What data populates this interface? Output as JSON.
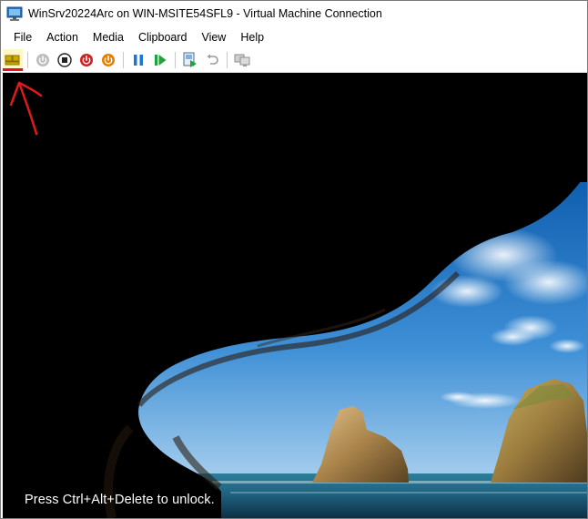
{
  "window": {
    "title": "WinSrv20224Arc on WIN-MSITE54SFL9 - Virtual Machine Connection"
  },
  "menu": {
    "items": [
      "File",
      "Action",
      "Media",
      "Clipboard",
      "View",
      "Help"
    ]
  },
  "toolbar": {
    "buttons": [
      {
        "icon": "ctrl-alt-del-icon",
        "state": "active"
      },
      {
        "icon": "start-icon",
        "state": "disabled"
      },
      {
        "icon": "turn-off-icon",
        "state": "enabled"
      },
      {
        "icon": "shut-down-icon",
        "state": "enabled"
      },
      {
        "icon": "save-icon",
        "state": "enabled"
      },
      {
        "icon": "pause-icon",
        "state": "enabled"
      },
      {
        "icon": "resume-icon",
        "state": "enabled"
      },
      {
        "icon": "checkpoint-icon",
        "state": "enabled"
      },
      {
        "icon": "revert-icon",
        "state": "disabled"
      },
      {
        "icon": "enhanced-session-icon",
        "state": "disabled"
      }
    ],
    "colors": {
      "active_highlight": "#fff6c7",
      "active_underline": "#e81123",
      "red": "#d21f1f",
      "orange": "#e67e00",
      "blue": "#1e73d6",
      "green": "#1fa33a"
    }
  },
  "screen": {
    "lock_message": "Press Ctrl+Alt+Delete to unlock."
  },
  "annotation": {
    "type": "red-arrow",
    "color": "#e01a1a"
  }
}
